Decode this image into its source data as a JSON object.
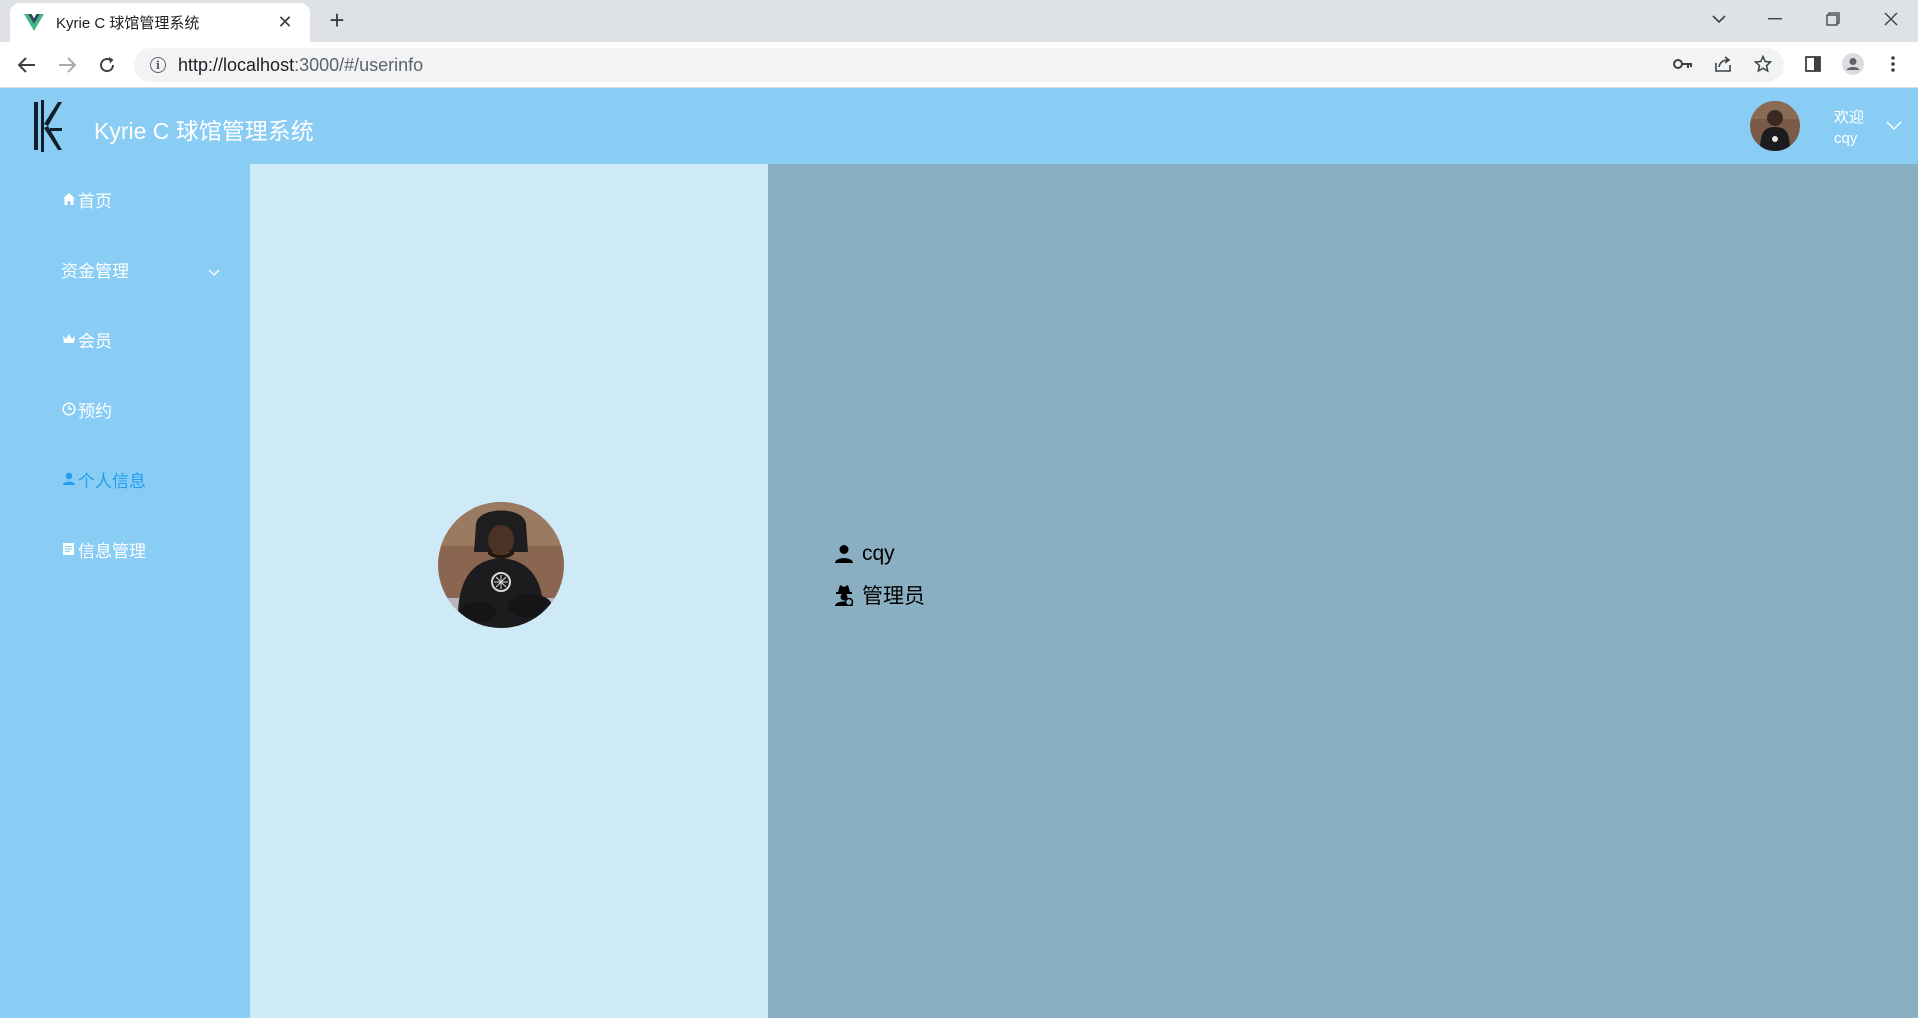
{
  "browser": {
    "tab_title": "Kyrie C 球馆管理系统",
    "url_host": "http://localhost",
    "url_path": ":3000/#/userinfo"
  },
  "header": {
    "app_title": "Kyrie C 球馆管理系统",
    "welcome_label": "欢迎",
    "username": "cqy"
  },
  "sidebar": {
    "items": [
      {
        "label": "首页",
        "icon": "home-icon"
      },
      {
        "label": "资金管理",
        "icon": "",
        "submenu": true
      },
      {
        "label": "会员",
        "icon": "crown-icon"
      },
      {
        "label": "预约",
        "icon": "clock-icon"
      },
      {
        "label": "个人信息",
        "icon": "user-icon",
        "active": true
      },
      {
        "label": "信息管理",
        "icon": "document-icon"
      }
    ]
  },
  "profile": {
    "username": "cqy",
    "role": "管理员"
  },
  "colors": {
    "header_bg": "#89cdf5",
    "sidebar_bg": "#89cdf5",
    "active_menu": "#1f9ff0",
    "panel_left_bg": "#cfeaf7",
    "panel_right_bg": "#8aafc2"
  }
}
